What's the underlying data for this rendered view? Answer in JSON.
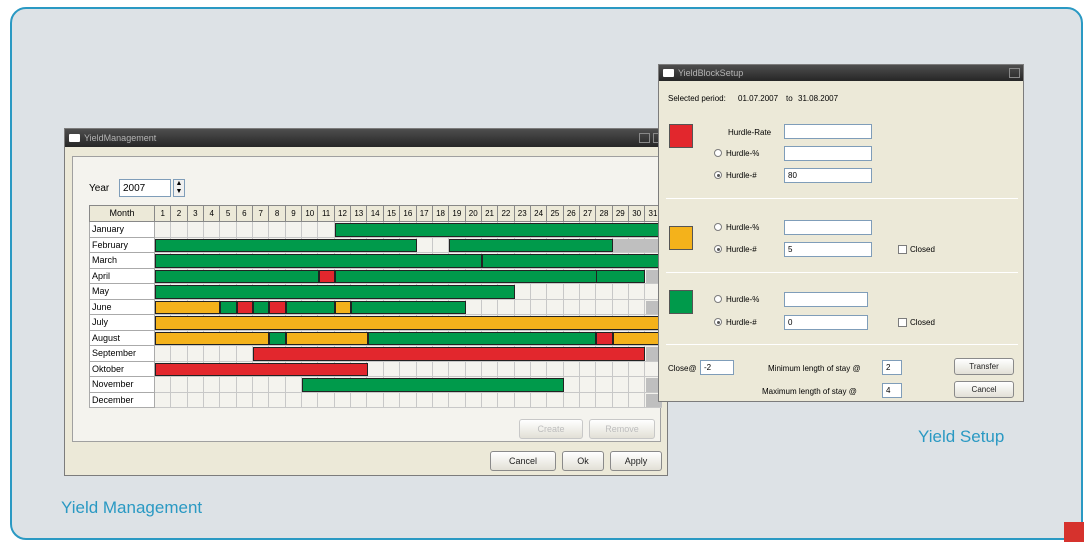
{
  "captions": {
    "yield_management": "Yield Management",
    "yield_setup": "Yield Setup"
  },
  "yield_management": {
    "title": "YieldManagement",
    "year_label": "Year",
    "year_value": "2007",
    "month_header": "Month",
    "days": [
      "1",
      "2",
      "3",
      "4",
      "5",
      "6",
      "7",
      "8",
      "9",
      "10",
      "11",
      "12",
      "13",
      "14",
      "15",
      "16",
      "17",
      "18",
      "19",
      "20",
      "21",
      "22",
      "23",
      "24",
      "25",
      "26",
      "27",
      "28",
      "29",
      "30",
      "31"
    ],
    "colors": {
      "G": "#009a4b",
      "Y": "#f4b21b",
      "R": "#e2272d",
      "X": "#bfbfbf"
    },
    "months": [
      {
        "name": "January",
        "bars": [
          {
            "from": 12,
            "to": 31,
            "color": "G"
          }
        ]
      },
      {
        "name": "February",
        "bars": [
          {
            "from": 1,
            "to": 16,
            "color": "G"
          },
          {
            "from": 19,
            "to": 28,
            "color": "G"
          },
          {
            "from": 29,
            "to": 31,
            "color": "X"
          }
        ]
      },
      {
        "name": "March",
        "bars": [
          {
            "from": 1,
            "to": 20,
            "color": "G"
          },
          {
            "from": 21,
            "to": 31,
            "color": "G"
          }
        ]
      },
      {
        "name": "April",
        "bars": [
          {
            "from": 1,
            "to": 10,
            "color": "G"
          },
          {
            "from": 11,
            "to": 11,
            "color": "R"
          },
          {
            "from": 12,
            "to": 28,
            "color": "G"
          },
          {
            "from": 28,
            "to": 30,
            "color": "G"
          },
          {
            "from": 31,
            "to": 31,
            "color": "X"
          }
        ]
      },
      {
        "name": "May",
        "bars": [
          {
            "from": 1,
            "to": 22,
            "color": "G"
          }
        ]
      },
      {
        "name": "June",
        "bars": [
          {
            "from": 1,
            "to": 4,
            "color": "Y"
          },
          {
            "from": 5,
            "to": 5,
            "color": "G"
          },
          {
            "from": 6,
            "to": 6,
            "color": "R"
          },
          {
            "from": 7,
            "to": 7,
            "color": "G"
          },
          {
            "from": 8,
            "to": 8,
            "color": "R"
          },
          {
            "from": 9,
            "to": 11,
            "color": "G"
          },
          {
            "from": 12,
            "to": 12,
            "color": "Y"
          },
          {
            "from": 13,
            "to": 19,
            "color": "G"
          },
          {
            "from": 31,
            "to": 31,
            "color": "X"
          }
        ]
      },
      {
        "name": "July",
        "bars": [
          {
            "from": 1,
            "to": 31,
            "color": "Y"
          }
        ]
      },
      {
        "name": "August",
        "bars": [
          {
            "from": 1,
            "to": 7,
            "color": "Y"
          },
          {
            "from": 8,
            "to": 8,
            "color": "G"
          },
          {
            "from": 9,
            "to": 13,
            "color": "Y"
          },
          {
            "from": 14,
            "to": 27,
            "color": "G"
          },
          {
            "from": 28,
            "to": 28,
            "color": "R"
          },
          {
            "from": 29,
            "to": 31,
            "color": "Y"
          }
        ]
      },
      {
        "name": "September",
        "bars": [
          {
            "from": 7,
            "to": 30,
            "color": "R"
          },
          {
            "from": 31,
            "to": 31,
            "color": "X"
          }
        ]
      },
      {
        "name": "Oktober",
        "bars": [
          {
            "from": 1,
            "to": 13,
            "color": "R"
          }
        ]
      },
      {
        "name": "November",
        "bars": [
          {
            "from": 10,
            "to": 25,
            "color": "G"
          },
          {
            "from": 31,
            "to": 31,
            "color": "X"
          }
        ]
      },
      {
        "name": "December",
        "bars": [
          {
            "from": 31,
            "to": 31,
            "color": "X"
          }
        ]
      }
    ],
    "buttons": {
      "create": "Create",
      "remove": "Remove",
      "cancel": "Cancel",
      "ok": "Ok",
      "apply": "Apply"
    }
  },
  "yield_setup": {
    "title": "YieldBlockSetup",
    "selected_period_label": "Selected period:",
    "period_from": "01.07.2007",
    "period_to_label": "to",
    "period_to": "31.08.2007",
    "sections": [
      {
        "color": "#e2272d",
        "hurdle_rate_label": "Hurdle-Rate",
        "hurdle_rate_value": "",
        "pct_label": "Hurdle-%",
        "pct_value": "",
        "num_label": "Hurdle-#",
        "num_value": "80"
      },
      {
        "color": "#f4b21b",
        "pct_label": "Hurdle-%",
        "pct_value": "",
        "num_label": "Hurdle-#",
        "num_value": "5",
        "closed_label": "Closed"
      },
      {
        "color": "#009a4b",
        "pct_label": "Hurdle-%",
        "pct_value": "",
        "num_label": "Hurdle-#",
        "num_value": "0",
        "closed_label": "Closed"
      }
    ],
    "close_label": "Close@",
    "close_value": "-2",
    "min_stay_label": "Minimum length of stay @",
    "min_stay_value": "2",
    "max_stay_label": "Maximum length of stay @",
    "max_stay_value": "4",
    "transfer_button": "Transfer",
    "cancel_button": "Cancel"
  }
}
